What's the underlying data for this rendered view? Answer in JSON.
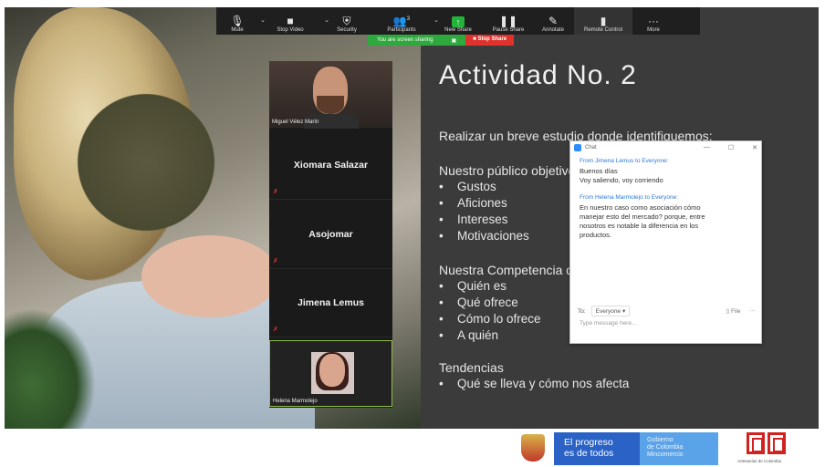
{
  "toolbar": {
    "buttons": [
      {
        "label": "Mute",
        "icon": "microphone-icon"
      },
      {
        "label": "Stop Video",
        "icon": "video-camera-icon"
      },
      {
        "label": "Security",
        "icon": "shield-icon"
      },
      {
        "label": "Participants",
        "icon": "participants-icon",
        "count": "3"
      },
      {
        "label": "New Share",
        "icon": "share-screen-icon"
      },
      {
        "label": "Pause Share",
        "icon": "pause-icon"
      },
      {
        "label": "Annotate",
        "icon": "pen-icon"
      },
      {
        "label": "Remote Control",
        "icon": "mouse-icon"
      },
      {
        "label": "More",
        "icon": "ellipsis-icon"
      }
    ],
    "sharing_status": "You are screen sharing",
    "stop_share": "Stop Share"
  },
  "participants": [
    {
      "name": "Miguel Vélez Marín",
      "has_video": true
    },
    {
      "name": "Xiomara Salazar",
      "has_video": false
    },
    {
      "name": "Asojomar",
      "has_video": false
    },
    {
      "name": "Jimena Lemus",
      "has_video": false
    },
    {
      "name": "Helena Marmolejo",
      "has_video": true
    }
  ],
  "slide": {
    "title": "Actividad No. 2",
    "intro": "Realizar un breve estudio donde identifiquemos:",
    "section1": "Nuestro público objetivo",
    "bullets1": [
      "Gustos",
      "Aficiones",
      "Intereses",
      "Motivaciones"
    ],
    "section2": "Nuestra Competencia d",
    "bullets2": [
      "Quién es",
      "Qué ofrece",
      "Cómo lo ofrece",
      "A quién"
    ],
    "section3": "Tendencias",
    "bullets3": [
      "Qué se lleva y cómo nos afecta"
    ]
  },
  "chat": {
    "title": "Chat",
    "messages": [
      {
        "from": "From Jimena Lemus to Everyone:",
        "lines": [
          "Buenos días",
          "Voy saliendo, voy corriendo"
        ]
      },
      {
        "from": "From Helena Marmolejo to Everyone:",
        "lines": [
          "En nuestro caso como asociación cómo",
          "manejar esto del mercado? porque, entre",
          "nosotros es notable la diferencia en los",
          "productos."
        ]
      }
    ],
    "to_label": "To:",
    "to_value": "Everyone ▾",
    "file_label": "File",
    "placeholder": "Type message here..."
  },
  "footer": {
    "progreso": [
      "El progreso",
      "es de todos"
    ],
    "gobierno": [
      "Gobierno",
      "de Colombia",
      "Mincomercio"
    ],
    "mincom_caption": "Artesanías de Colombia"
  },
  "colors": {
    "toolbar_bg": "#1f1f1f",
    "share_green": "#2fa93d",
    "stop_red": "#e0322d",
    "slide_bg": "#3b3b3b",
    "progreso_blue": "#2b62c6",
    "gobierno_blue": "#5aa3e8",
    "mincom_red": "#d1221f"
  }
}
